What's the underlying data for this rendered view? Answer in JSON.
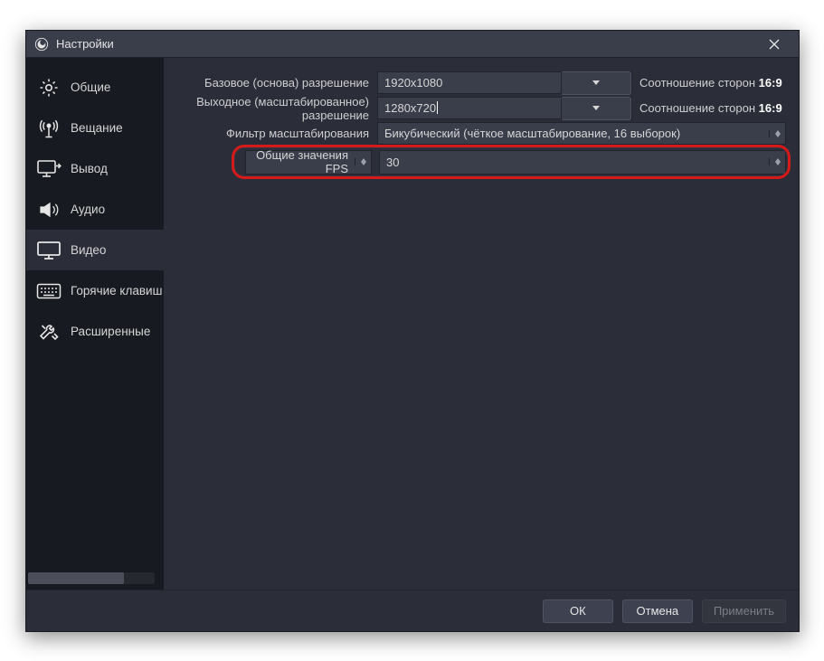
{
  "window": {
    "title": "Настройки"
  },
  "sidebar": {
    "items": [
      {
        "label": "Общие"
      },
      {
        "label": "Вещание"
      },
      {
        "label": "Вывод"
      },
      {
        "label": "Аудио"
      },
      {
        "label": "Видео"
      },
      {
        "label": "Горячие клавиш"
      },
      {
        "label": "Расширенные"
      }
    ],
    "active_index": 4
  },
  "form": {
    "base_res": {
      "label": "Базовое (основа) разрешение",
      "value": "1920x1080",
      "ratio_label": "Соотношение сторон",
      "ratio_value": "16:9"
    },
    "out_res": {
      "label": "Выходное (масштабированное) разрешение",
      "value": "1280x720",
      "ratio_label": "Соотношение сторон",
      "ratio_value": "16:9"
    },
    "filter": {
      "label": "Фильтр масштабирования",
      "value": "Бикубический (чёткое масштабирование, 16 выборок)"
    },
    "fps": {
      "label": "Общие значения FPS",
      "value": "30"
    }
  },
  "footer": {
    "ok": "ОК",
    "cancel": "Отмена",
    "apply": "Применить"
  },
  "colors": {
    "highlight": "#d61a1a",
    "window_bg": "#2b2e38",
    "sidebar_bg": "#181a21",
    "control_bg": "#3a3d4a"
  }
}
